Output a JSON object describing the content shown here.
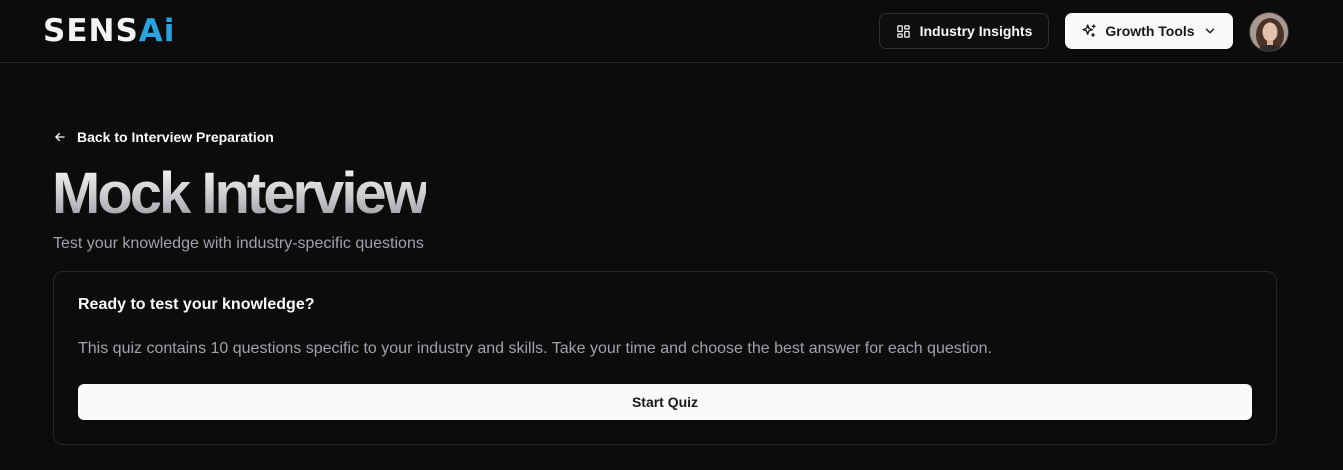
{
  "header": {
    "logo": {
      "part1": "SENS",
      "part2": "Ai"
    },
    "industry_insights_label": "Industry Insights",
    "growth_tools_label": "Growth Tools",
    "icons": {
      "insights": "layout-dashboard-icon",
      "growth": "sparkles-icon",
      "growth_caret": "chevron-down-icon"
    }
  },
  "main": {
    "back_link": "Back to Interview Preparation",
    "title": "Mock Interview",
    "subtitle": "Test your knowledge with industry-specific questions"
  },
  "card": {
    "title": "Ready to test your knowledge?",
    "description": "This quiz contains 10 questions specific to your industry and skills. Take your time and choose the best answer for each question.",
    "start_button": "Start Quiz"
  },
  "colors": {
    "background": "#0c0c0d",
    "accent_blue": "#29a3e0",
    "border": "#27272a",
    "muted_text": "#a1a1aa"
  }
}
